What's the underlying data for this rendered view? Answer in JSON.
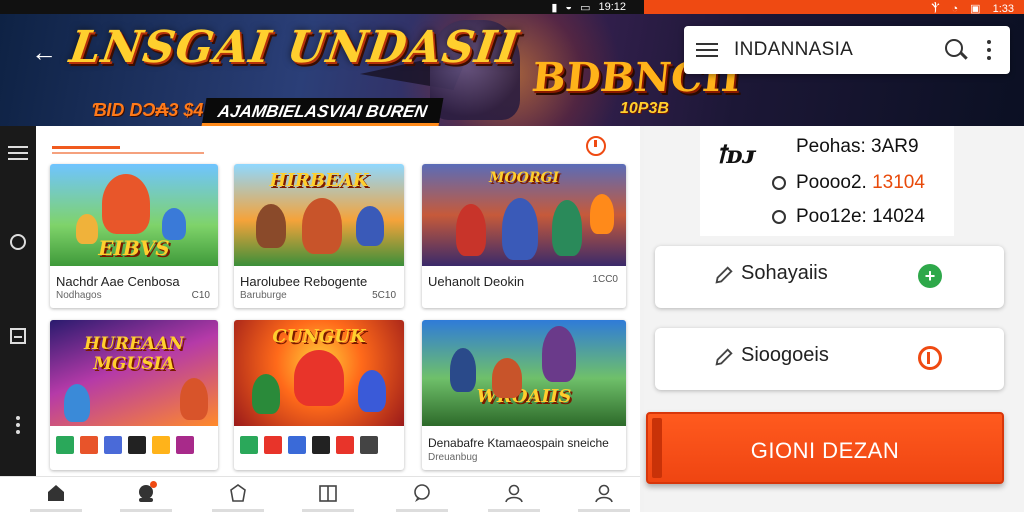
{
  "status_bar": {
    "left_time": "19:12",
    "right_time": "1:33"
  },
  "banner": {
    "title": "LNSGAI UNDASII",
    "price": "ƁID DƆ₳3 $4",
    "subtitle": "AJAMBIELASVIAI BUREN",
    "logo": "BDBNCII",
    "logo_sub": "10P3B"
  },
  "search": {
    "value": "INDANNASIA"
  },
  "games": [
    {
      "badge": "EIBVS",
      "title": "Nachdr Aae Cenbosa",
      "meta": "Nodhagos",
      "count": "C10"
    },
    {
      "badge": "HIRBEAK",
      "title": "Harolubee Rebogente",
      "meta": "Baruburge",
      "count": "5C10"
    },
    {
      "badge": "MOORGI",
      "title": "Uehanolt Deokin",
      "meta": "",
      "count": "1CC0"
    },
    {
      "badge": "HUREAAN MGUSIA",
      "title": "",
      "meta": "",
      "count": ""
    },
    {
      "badge": "CUNGUK",
      "title": "",
      "meta": "",
      "count": ""
    },
    {
      "badge": "WROAIIS",
      "title": "Denabafre Ktamaeospain sneiche",
      "meta": "Dreuanbug",
      "count": ""
    }
  ],
  "info": {
    "brand": "ꝉᴅᴊ",
    "line1": "Peohas: 3AR9",
    "line2_label": "Poooo2.",
    "line2_value": "13104",
    "line3": "Poo12e: 14024"
  },
  "actions": [
    {
      "label": "Sohayaiis",
      "status": "plus"
    },
    {
      "label": "Sioogoeis",
      "status": "alert"
    }
  ],
  "cta": {
    "label": "GIONI DEZAN"
  },
  "colors": {
    "accent": "#ef4a12",
    "success": "#2ea84a"
  },
  "icons": [
    "back-arrow-icon",
    "menu-icon",
    "search-icon",
    "more-vert-icon",
    "pencil-icon",
    "home-icon",
    "profile-icon"
  ]
}
